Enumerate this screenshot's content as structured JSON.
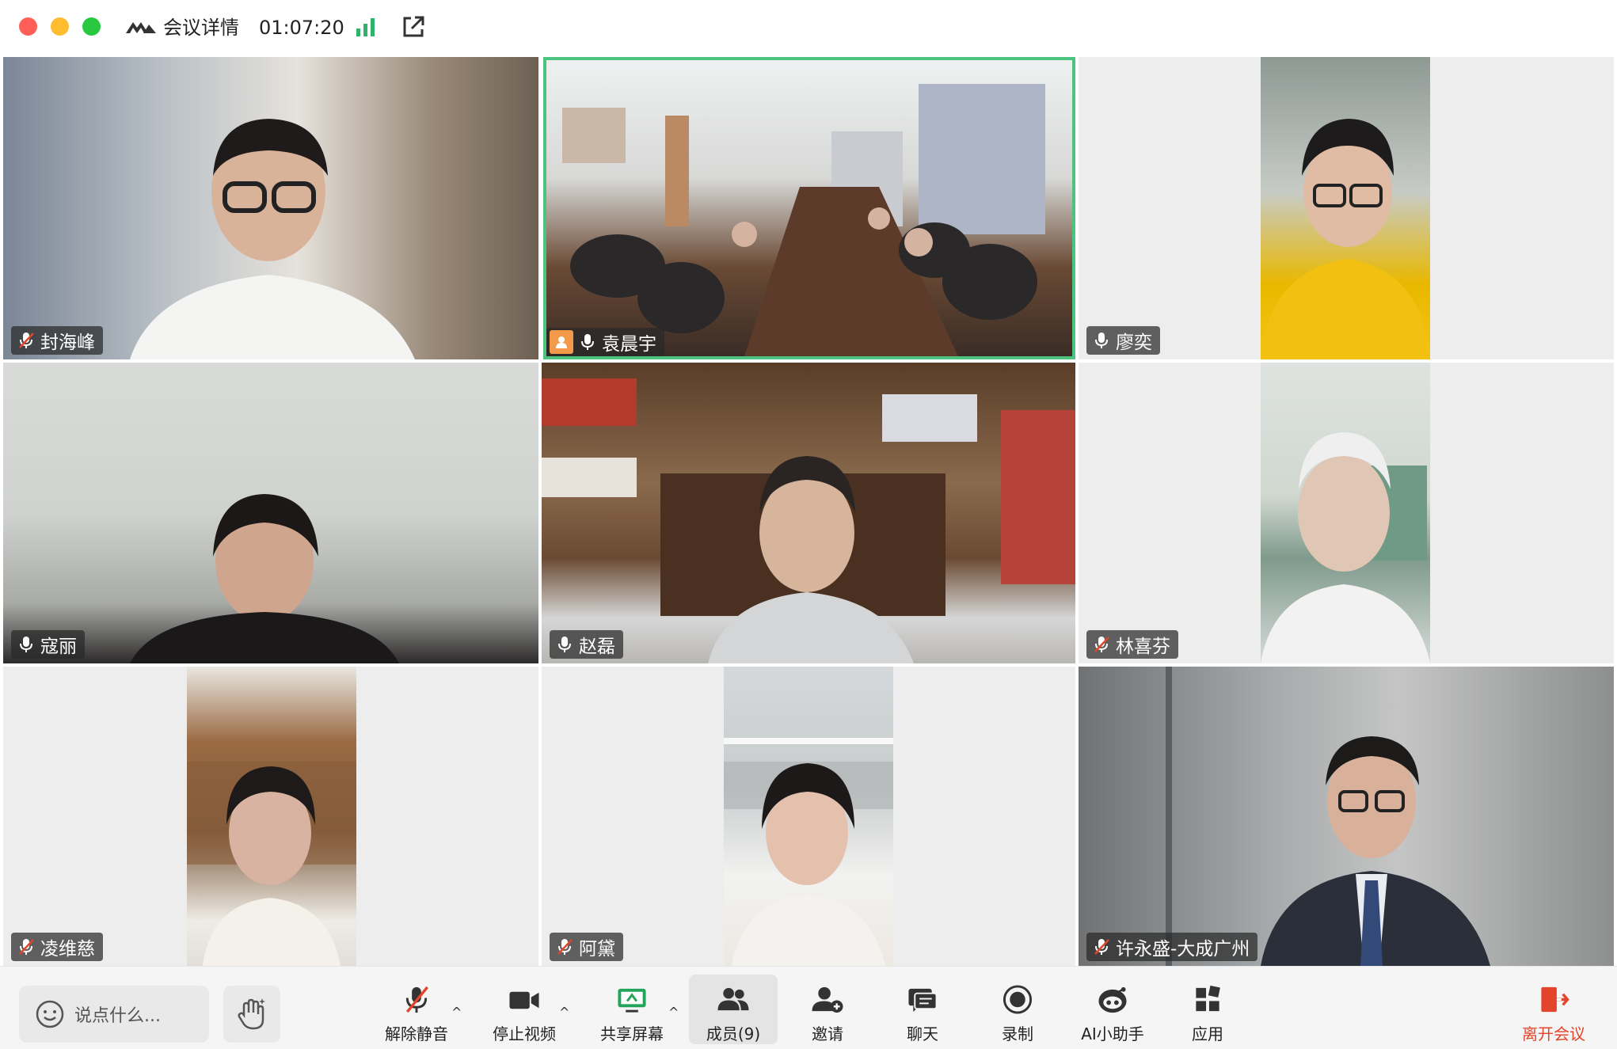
{
  "window": {
    "title": "会议详情",
    "timer": "01:07:20"
  },
  "participants": [
    {
      "name": "封海峰",
      "mic": "muted",
      "active": false
    },
    {
      "name": "袁晨宇",
      "mic": "on",
      "active": true,
      "host": true
    },
    {
      "name": "廖奕",
      "mic": "on",
      "active": false
    },
    {
      "name": "寇丽",
      "mic": "on",
      "active": false
    },
    {
      "name": "赵磊",
      "mic": "on",
      "active": false
    },
    {
      "name": "林喜芬",
      "mic": "muted",
      "active": false
    },
    {
      "name": "凌维慈",
      "mic": "muted",
      "active": false
    },
    {
      "name": "阿黛",
      "mic": "muted",
      "active": false
    },
    {
      "name": "许永盛-大成广州",
      "mic": "muted",
      "active": false
    }
  ],
  "toolbar": {
    "chat_placeholder": "说点什么...",
    "unmute": "解除静音",
    "stop_video": "停止视频",
    "share_screen": "共享屏幕",
    "members": "成员(9)",
    "invite": "邀请",
    "chat": "聊天",
    "record": "录制",
    "ai_assistant": "AI小助手",
    "apps": "应用",
    "leave": "离开会议"
  },
  "colors": {
    "active_border": "#4cc37e",
    "leave": "#e2452c",
    "share_green": "#22a45a",
    "mute_slash": "#e2452c"
  }
}
